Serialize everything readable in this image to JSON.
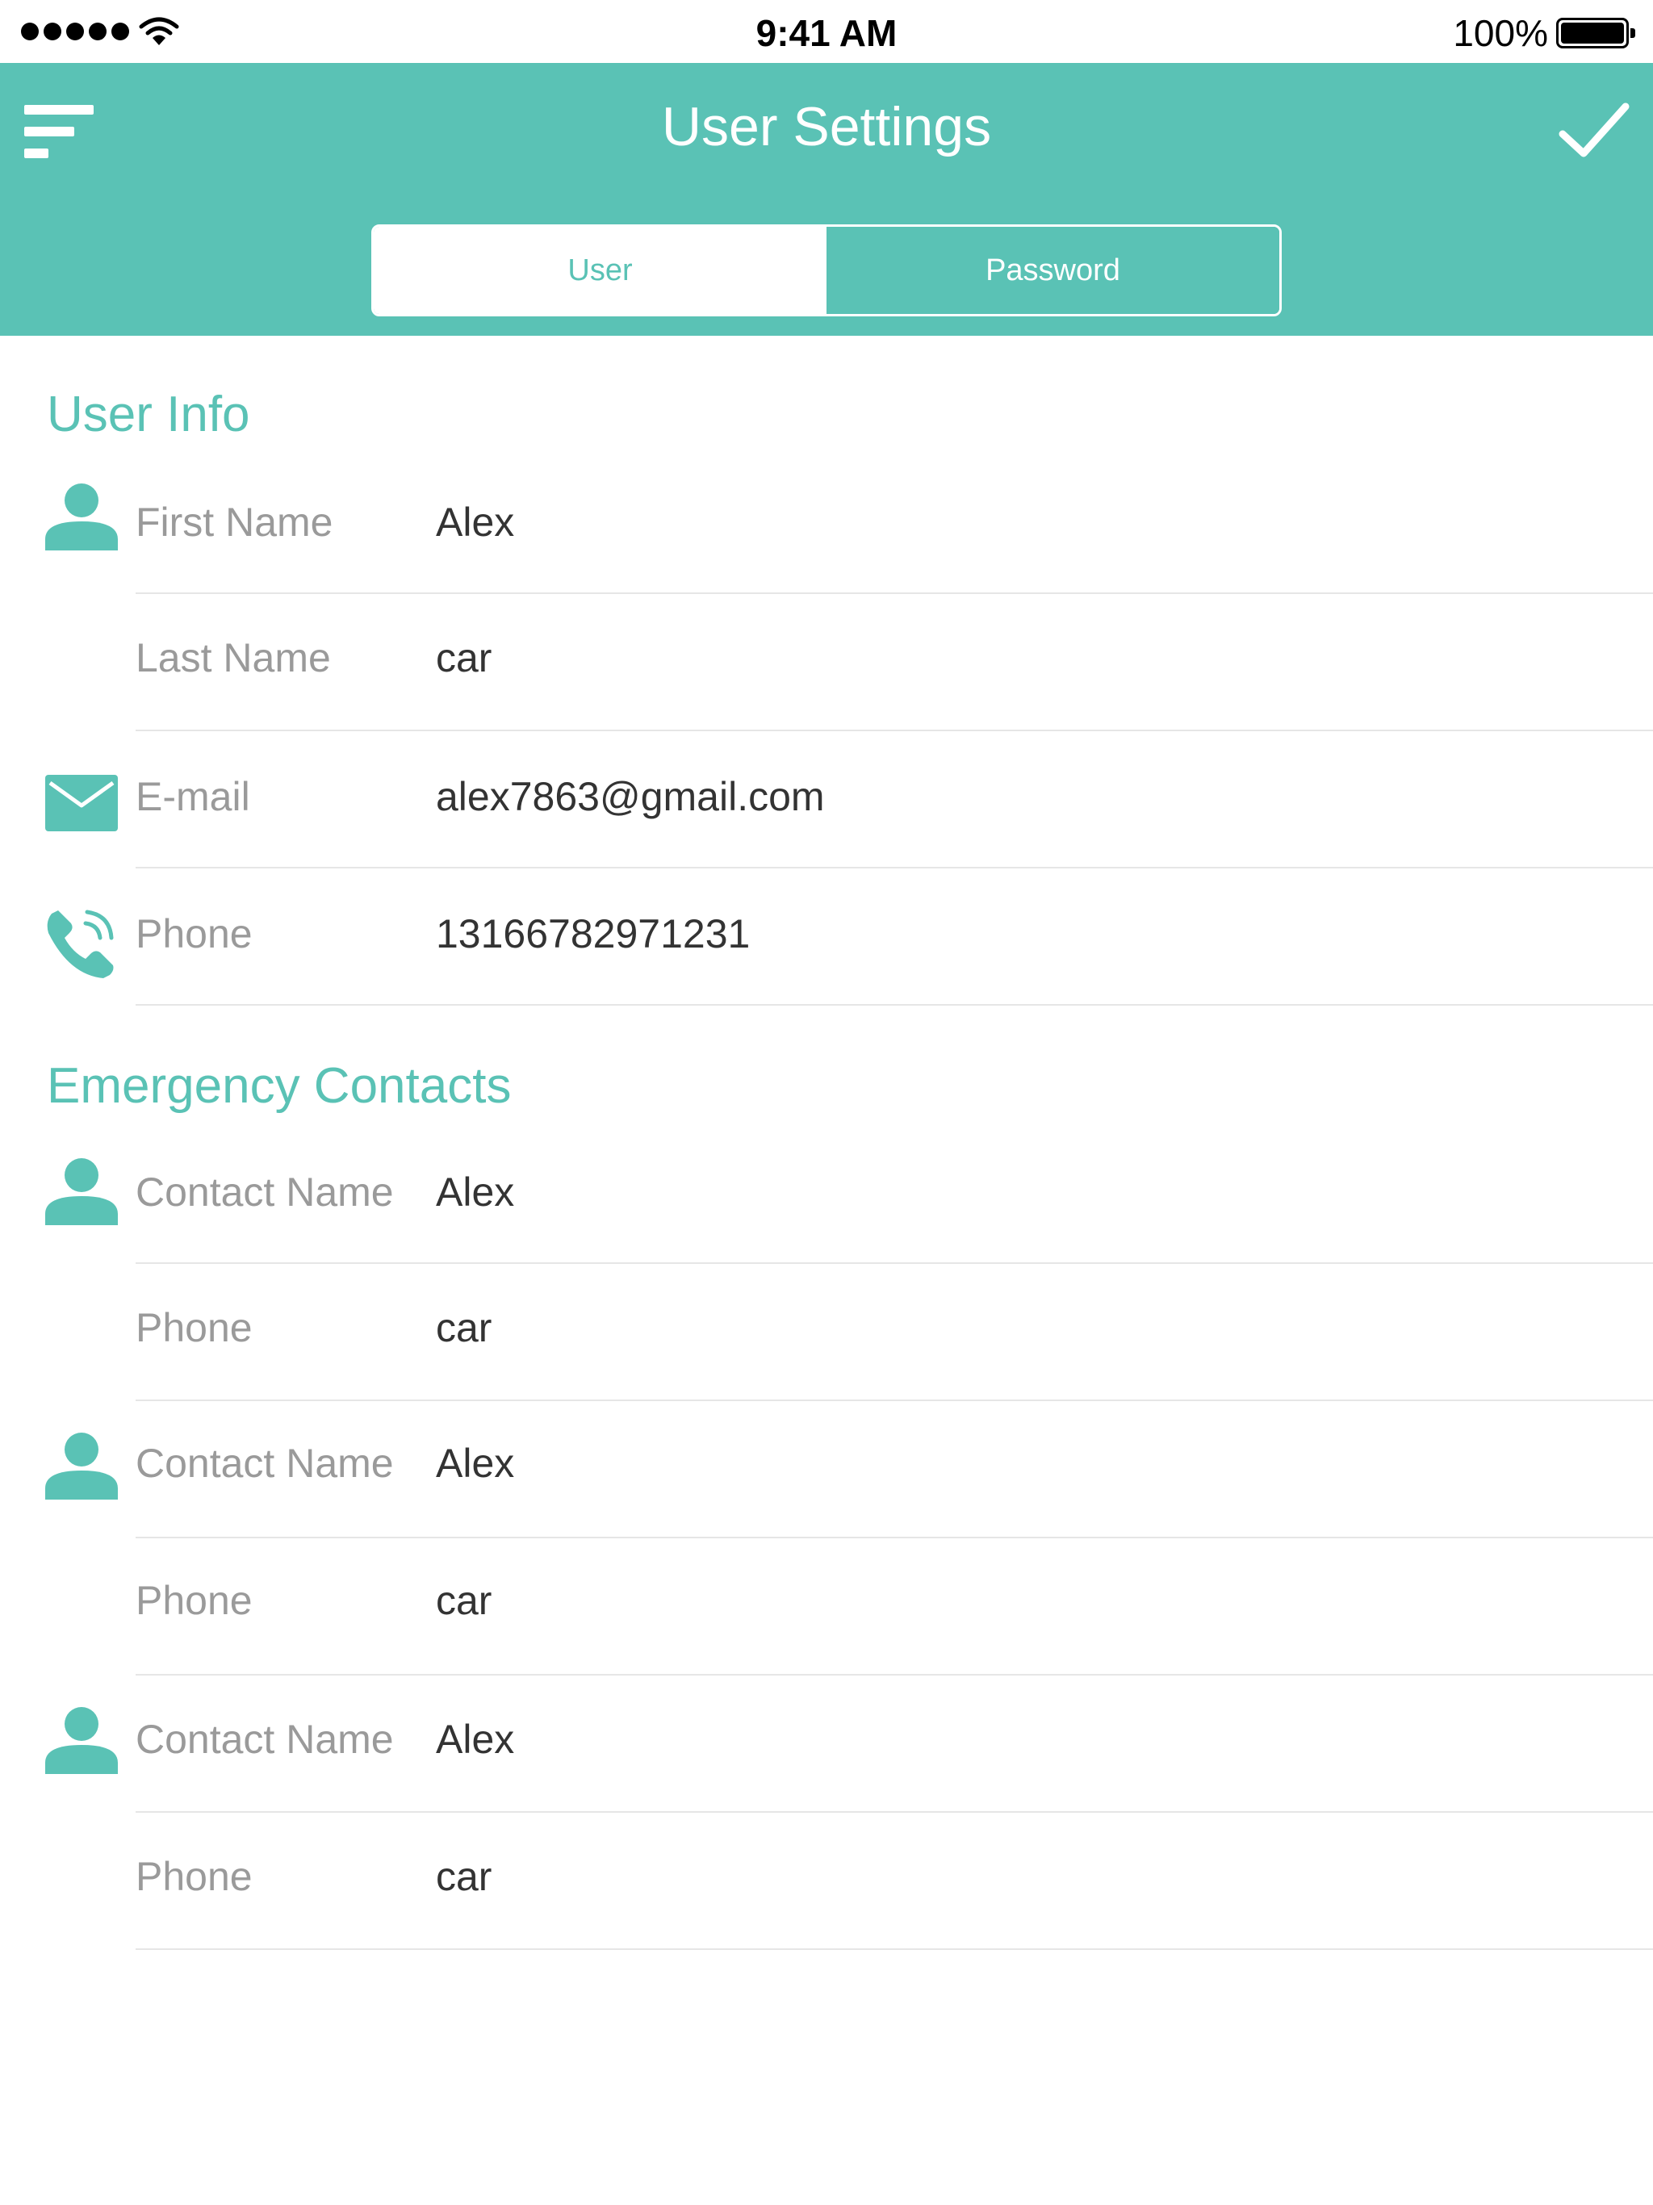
{
  "status_bar": {
    "time": "9:41 AM",
    "battery": "100%"
  },
  "header": {
    "title": "User Settings",
    "tabs": [
      {
        "label": "User",
        "active": true
      },
      {
        "label": "Password",
        "active": false
      }
    ]
  },
  "user_info": {
    "title": "User Info",
    "rows": [
      {
        "icon": "person-icon",
        "label": "First Name",
        "value": "Alex"
      },
      {
        "icon": "",
        "label": "Last Name",
        "value": "car"
      },
      {
        "icon": "mail-icon",
        "label": "E-mail",
        "value": "alex7863@gmail.com"
      },
      {
        "icon": "phone-icon",
        "label": "Phone",
        "value": "13166782971231"
      }
    ]
  },
  "emergency_contacts": {
    "title": "Emergency Contacts",
    "rows": [
      {
        "icon": "person-icon",
        "label": "Contact Name",
        "value": "Alex"
      },
      {
        "icon": "",
        "label": "Phone",
        "value": "car"
      },
      {
        "icon": "person-icon",
        "label": "Contact Name",
        "value": "Alex"
      },
      {
        "icon": "",
        "label": "Phone",
        "value": "car"
      },
      {
        "icon": "person-icon",
        "label": "Contact Name",
        "value": "Alex"
      },
      {
        "icon": "",
        "label": "Phone",
        "value": "car"
      }
    ]
  },
  "colors": {
    "accent": "#5ac2b5",
    "label": "#9a9a9a",
    "value": "#333333",
    "divider": "#e6e6e6"
  }
}
